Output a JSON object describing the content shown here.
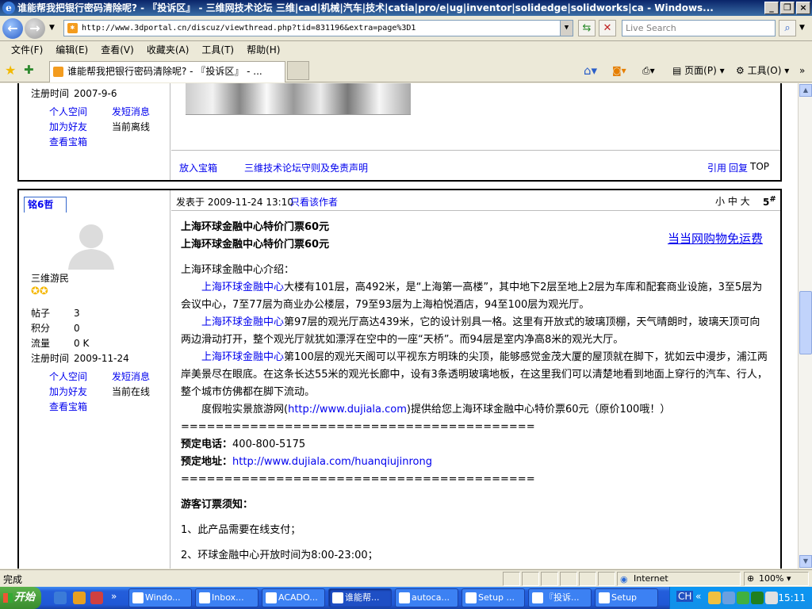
{
  "window": {
    "title": "谁能帮我把银行密码清除呢? - 『投诉区』 - 三维网技术论坛 三维|cad|机械|汽车|技术|catia|pro/e|ug|inventor|solidedge|solidworks|ca - Windows..."
  },
  "address_bar": {
    "url": "http://www.3dportal.cn/discuz/viewthread.php?tid=831196&extra=page%3D1",
    "search_placeholder": "Live Search"
  },
  "menu": [
    "文件(F)",
    "编辑(E)",
    "查看(V)",
    "收藏夹(A)",
    "工具(T)",
    "帮助(H)"
  ],
  "tab": {
    "label": "谁能帮我把银行密码清除呢? - 『投诉区』 - ..."
  },
  "command_bar": {
    "page": "页面(P)",
    "tools": "工具(O)"
  },
  "post1": {
    "reg_label": "注册时间",
    "reg_date": "2007-9-6",
    "links": {
      "space": "个人空间",
      "message": "发短消息",
      "friend": "加为好友",
      "status": "当前离线",
      "treasure": "查看宝箱"
    },
    "footer": {
      "put_box": "放入宝箱",
      "rules": "三维技术论坛守则及免责声明",
      "quote": "引用",
      "reply": "回复",
      "top": "TOP"
    }
  },
  "post2": {
    "username": "铭6哲",
    "posted_at": "发表于 2009-11-24 13:10",
    "only_author": "只看该作者",
    "font_sizes": "小 中 大",
    "floor_num": "5",
    "floor_sym": "#",
    "user_title": "三维游民",
    "stats": [
      {
        "label": "帖子",
        "value": "3"
      },
      {
        "label": "积分",
        "value": "0"
      },
      {
        "label": "流量",
        "value": "0 K"
      },
      {
        "label": "注册时间",
        "value": "2009-11-24"
      }
    ],
    "links": {
      "space": "个人空间",
      "message": "发短消息",
      "friend": "加为好友",
      "status": "当前在线",
      "treasure": "查看宝箱"
    },
    "promo_link": "当当网购物免运费",
    "content": {
      "heading1": "上海环球金融中心特价门票60元",
      "heading2": "上海环球金融中心特价门票60元",
      "intro": "上海环球金融中心介绍：",
      "linkword": "上海环球金融中心",
      "p1": "大楼有101层，高492米，是“上海第一高楼”，其中地下2层至地上2层为车库和配套商业设施，3至5层为会议中心，7至77层为商业办公楼层，79至93层为上海柏悦酒店，94至100层为观光厅。",
      "p2": "第97层的观光厅高达439米，它的设计别具一格。这里有开放式的玻璃顶棚，天气晴朗时，玻璃天顶可向两边滑动打开，整个观光厅就犹如漂浮在空中的一座“天桥”。而94层是室内净高8米的观光大厅。",
      "p3": "第100层的观光天阁可以平视东方明珠的尖顶，能够感觉金茂大厦的屋顶就在脚下，犹如云中漫步，浦江两岸美景尽在眼底。在这条长达55米的观光长廊中，设有3条透明玻璃地板，在这里我们可以清楚地看到地面上穿行的汽车、行人，整个城市仿佛都在脚下流动。",
      "p4_pre": "度假啦实景旅游网(",
      "p4_link": "http://www.dujiala.com",
      "p4_post": ")提供给您上海环球金融中心特价票60元（原价100哦！）",
      "separator": "=========================================",
      "phone_label": "预定电话",
      "phone": "400-800-5175",
      "addr_label": "预定地址",
      "addr_link": "http://www.dujiala.com/huanqiujinrong",
      "notice_title": "游客订票须知：",
      "item1": "1、此产品需要在线支付；",
      "item2": "2、环球金融中心开放时间为8:00-23:00；"
    }
  },
  "statusbar": {
    "text": "完成",
    "zone": "Internet",
    "zoom": "100%"
  },
  "taskbar": {
    "start": "开始",
    "tasks": [
      "Windo...",
      "Inbox...",
      "ACADO...",
      "谁能帮...",
      "autoca...",
      "Setup ...",
      "『投诉...",
      "Setup"
    ],
    "clock": "15:11"
  }
}
